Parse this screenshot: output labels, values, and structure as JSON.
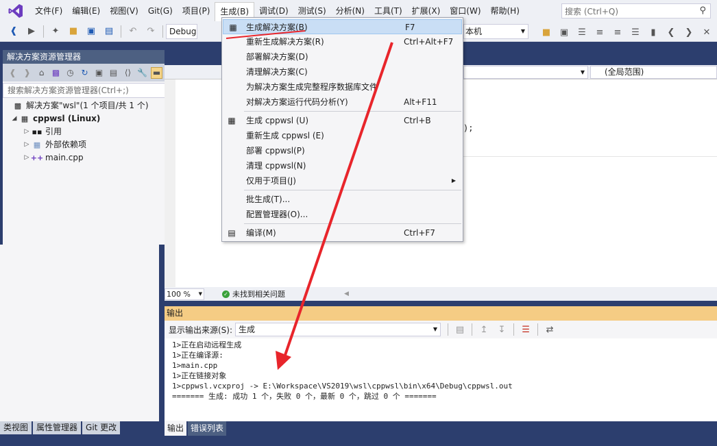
{
  "menubar": {
    "items": [
      "文件(F)",
      "编辑(E)",
      "视图(V)",
      "Git(G)",
      "项目(P)",
      "生成(B)",
      "调试(D)",
      "测试(S)",
      "分析(N)",
      "工具(T)",
      "扩展(X)",
      "窗口(W)",
      "帮助(H)"
    ],
    "search_placeholder": "搜索 (Ctrl+Q)"
  },
  "toolbar": {
    "config": "Debug",
    "target_suffix": "本机"
  },
  "solution_explorer": {
    "title": "解决方案资源管理器",
    "search_placeholder": "搜索解决方案资源管理器(Ctrl+;)",
    "solution": "解决方案\"wsl\"(1 个项目/共 1 个)",
    "project": "cppwsl (Linux)",
    "items": [
      "引用",
      "外部依赖项",
      "main.cpp"
    ]
  },
  "left_tabs": [
    "类视图",
    "属性管理器",
    "Git 更改"
  ],
  "editor": {
    "scope": "(全局范围)",
    "code_fragment": ");",
    "zoom": "100 %",
    "issue_status": "未找到相关问题"
  },
  "build_menu": {
    "items": [
      {
        "label": "生成解决方案(B)",
        "shortcut": "F7",
        "highlighted": true
      },
      {
        "label": "重新生成解决方案(R)",
        "shortcut": "Ctrl+Alt+F7"
      },
      {
        "label": "部署解决方案(D)",
        "shortcut": ""
      },
      {
        "label": "清理解决方案(C)",
        "shortcut": ""
      },
      {
        "label": "为解决方案生成完整程序数据库文件",
        "shortcut": ""
      },
      {
        "label": "对解决方案运行代码分析(Y)",
        "shortcut": "Alt+F11"
      },
      {
        "label": "生成 cppwsl (U)",
        "shortcut": "Ctrl+B"
      },
      {
        "label": "重新生成 cppwsl (E)",
        "shortcut": ""
      },
      {
        "label": "部署 cppwsl(P)",
        "shortcut": ""
      },
      {
        "label": "清理 cppwsl(N)",
        "shortcut": ""
      },
      {
        "label": "仅用于项目(J)",
        "shortcut": ""
      },
      {
        "label": "批生成(T)...",
        "shortcut": ""
      },
      {
        "label": "配置管理器(O)...",
        "shortcut": ""
      },
      {
        "label": "编译(M)",
        "shortcut": "Ctrl+F7"
      }
    ]
  },
  "output": {
    "title": "输出",
    "source_label": "显示输出来源(S):",
    "source_value": "生成",
    "lines": [
      "1>正在启动远程生成",
      "1>正在编译源:",
      "1>main.cpp",
      "1>正在链接对象",
      "1>cppwsl.vcxproj -> E:\\Workspace\\VS2019\\wsl\\cppwsl\\bin\\x64\\Debug\\cppwsl.out",
      "======= 生成: 成功 1 个，失败 0 个，最新 0 个，跳过 0 个 ======="
    ],
    "tabs": [
      "输出",
      "错误列表"
    ]
  },
  "colors": {
    "accent_band": "#2c3e6e",
    "output_title": "#f5cc84",
    "annotation": "#e8252b"
  }
}
